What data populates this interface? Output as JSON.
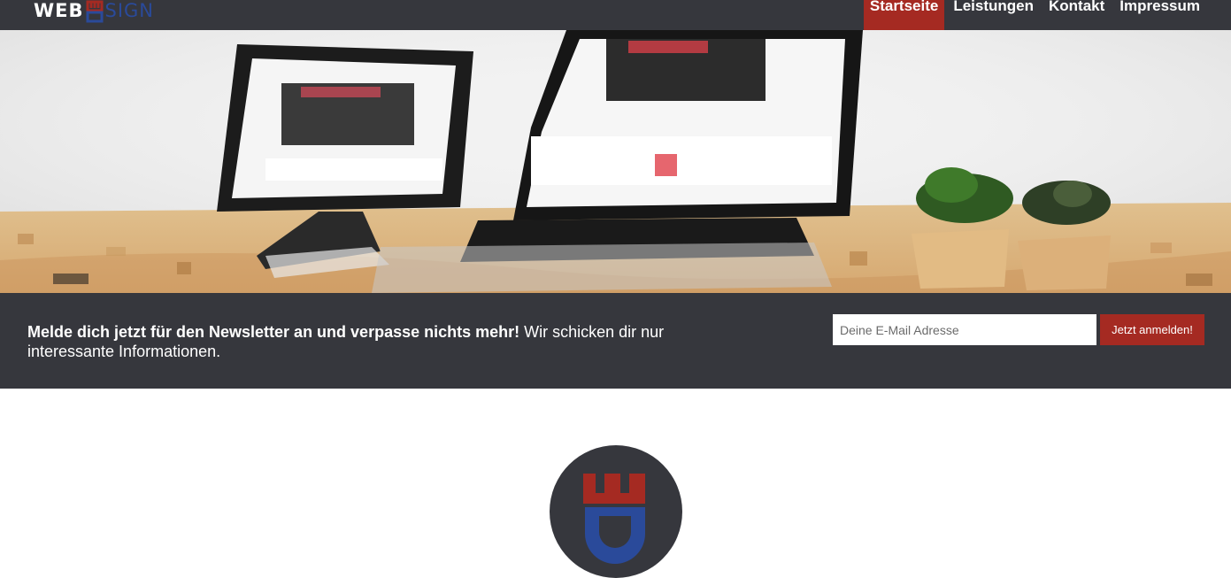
{
  "brand": {
    "logo_left": "WEB",
    "logo_right": "SIGN",
    "red": "#a52a22",
    "blue": "#2a4a9a",
    "dark": "#36373d"
  },
  "nav": {
    "items": [
      {
        "label": "Startseite",
        "active": true
      },
      {
        "label": "Leistungen",
        "active": false
      },
      {
        "label": "Kontakt",
        "active": false
      },
      {
        "label": "Impressum",
        "active": false
      }
    ]
  },
  "newsletter": {
    "headline": "Melde dich jetzt für den Newsletter an und verpasse nichts mehr!",
    "subtext": " Wir schicken dir nur interessante Informationen.",
    "email_placeholder": "Deine E-Mail Adresse",
    "submit_label": "Jetzt anmelden!"
  },
  "icons": {
    "logo_mark": "web-design-mark-icon",
    "badge_mark": "web-design-mark-icon"
  }
}
